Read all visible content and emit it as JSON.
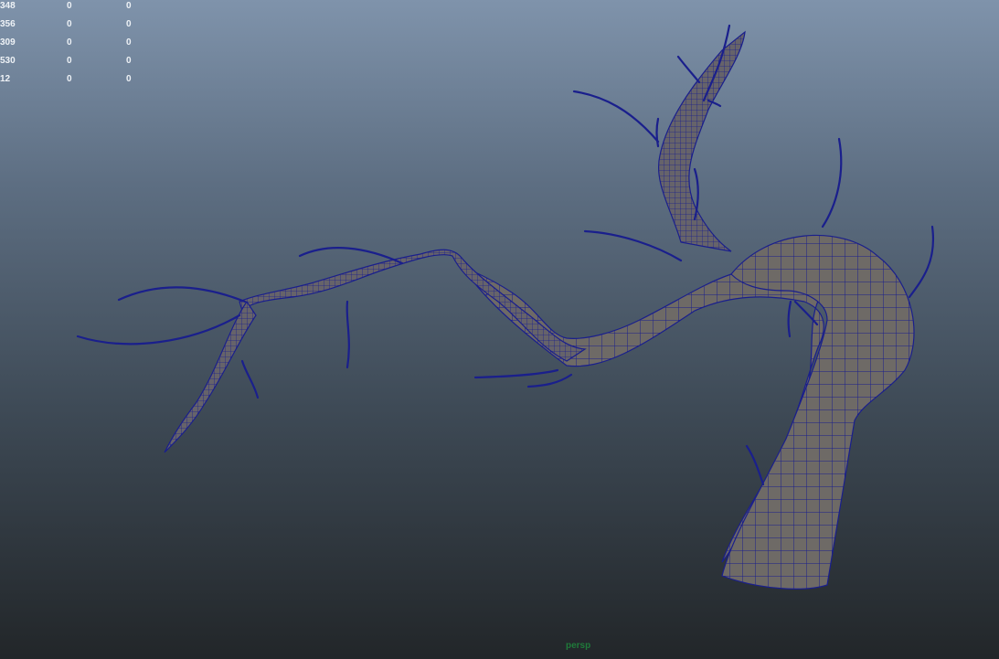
{
  "viewport": {
    "camera_name": "persp",
    "background_top_color": "#7f93ab",
    "background_bottom_color": "#222629",
    "wireframe_color": "#1a1f8c",
    "shaded_color": "#6e6a66"
  },
  "hud": {
    "rows": [
      {
        "label": "348",
        "a": "0",
        "b": "0"
      },
      {
        "label": "356",
        "a": "0",
        "b": "0"
      },
      {
        "label": "309",
        "a": "0",
        "b": "0"
      },
      {
        "label": "530",
        "a": "0",
        "b": "0"
      },
      {
        "label": "12",
        "a": "0",
        "b": "0"
      }
    ]
  },
  "scene": {
    "object": "tree-branch-mesh",
    "display_mode": "wireframe-on-shaded"
  }
}
